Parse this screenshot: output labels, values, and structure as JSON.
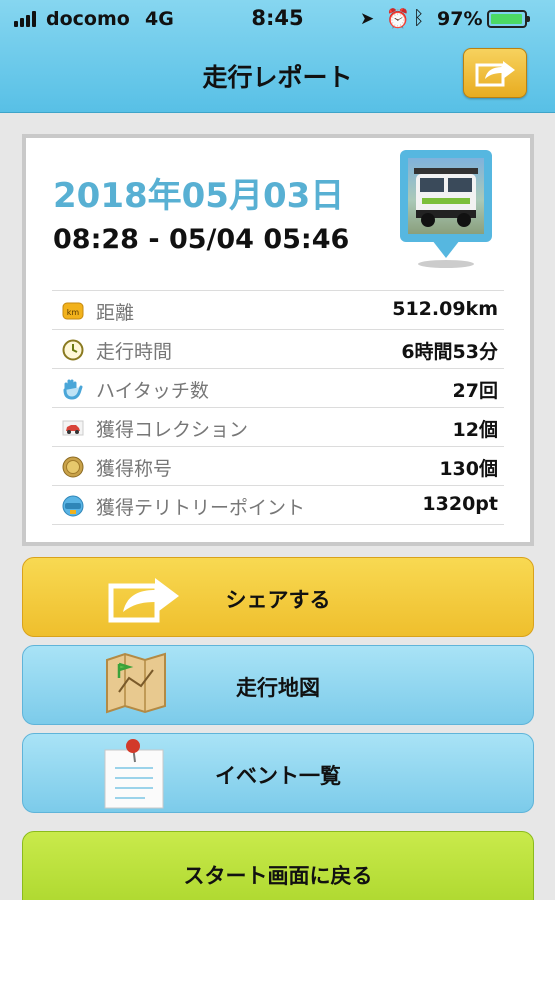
{
  "status_bar": {
    "carrier": "docomo",
    "network": "4G",
    "time": "8:45",
    "battery_percent": "97%",
    "battery_level": 0.97
  },
  "header": {
    "title": "走行レポート",
    "share_icon": "share-arrow-icon"
  },
  "report": {
    "date": "2018年05月03日",
    "time_range": "08:28 - 05/04 05:46",
    "vehicle_icon": "vehicle-photo-pin",
    "stats": [
      {
        "icon": "km-icon",
        "label": "距離",
        "value": "512.09km"
      },
      {
        "icon": "clock-icon",
        "label": "走行時間",
        "value": "6時間53分"
      },
      {
        "icon": "hand-icon",
        "label": "ハイタッチ数",
        "value": "27回"
      },
      {
        "icon": "car-icon",
        "label": "獲得コレクション",
        "value": "12個"
      },
      {
        "icon": "medal-icon",
        "label": "獲得称号",
        "value": "130個"
      },
      {
        "icon": "spot-icon",
        "label": "獲得テリトリーポイント",
        "value": "1320pt"
      }
    ]
  },
  "buttons": {
    "share": "シェアする",
    "map": "走行地図",
    "events": "イベント一覧",
    "back_to_start": "スタート画面に戻る"
  },
  "colors": {
    "header_blue": "#6ccbed",
    "date_blue": "#58b0d3",
    "share_yellow": "#f3c83c",
    "nav_blue": "#8fd4ef",
    "back_green": "#b9df36"
  }
}
